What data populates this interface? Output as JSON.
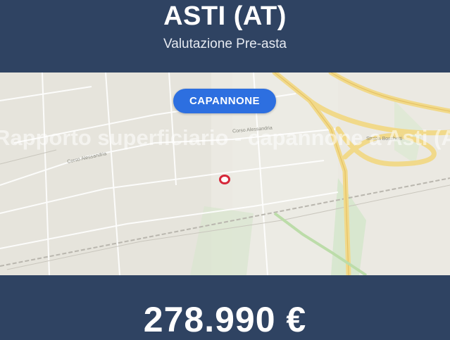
{
  "header": {
    "title": "ASTI (AT)",
    "subtitle": "Valutazione Pre-asta"
  },
  "map": {
    "category_badge": "CAPANNONE",
    "watermark": "Rapporto superficiario - capannone a Asti (AT)",
    "street_labels": [
      "Corso Alessandria",
      "Corso Alessandria",
      "Strada Boschetti"
    ],
    "marker_icon": "location-pin-icon"
  },
  "footer": {
    "price": "278.990 €"
  },
  "colors": {
    "header_bg": "#2f4362",
    "badge_bg": "#2d6fe0",
    "pin": "#d6283a",
    "map_bg": "#ebe9e2",
    "highway": "#f1d98a",
    "green": "#cfe3c4"
  }
}
